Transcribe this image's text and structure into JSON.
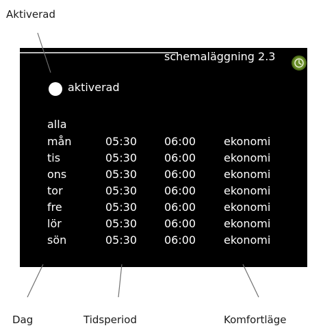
{
  "callouts": {
    "activated": "Aktiverad",
    "day": "Dag",
    "time_period": "Tidsperiod",
    "comfort_mode": "Komfortläge"
  },
  "screen": {
    "title": "schemaläggning 2.3",
    "status_icon": "clock-icon",
    "accent_color": "#6b8e2a",
    "activated_label": "aktiverad",
    "activated": true
  },
  "schedule": {
    "all_label": "alla",
    "rows": [
      {
        "day": "mån",
        "start": "05:30",
        "end": "06:00",
        "mode": "ekonomi"
      },
      {
        "day": "tis",
        "start": "05:30",
        "end": "06:00",
        "mode": "ekonomi"
      },
      {
        "day": "ons",
        "start": "05:30",
        "end": "06:00",
        "mode": "ekonomi"
      },
      {
        "day": "tor",
        "start": "05:30",
        "end": "06:00",
        "mode": "ekonomi"
      },
      {
        "day": "fre",
        "start": "05:30",
        "end": "06:00",
        "mode": "ekonomi"
      },
      {
        "day": "lör",
        "start": "05:30",
        "end": "06:00",
        "mode": "ekonomi"
      },
      {
        "day": "sön",
        "start": "05:30",
        "end": "06:00",
        "mode": "ekonomi"
      }
    ]
  }
}
